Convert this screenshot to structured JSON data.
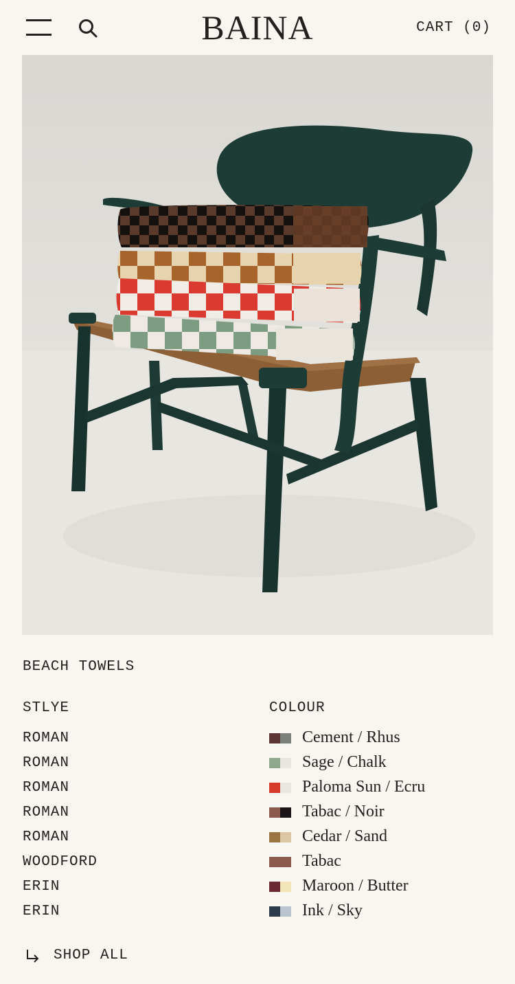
{
  "header": {
    "logo": "BAINA",
    "cart_label": "CART (0)"
  },
  "section": {
    "title": "BEACH TOWELS",
    "style_heading": "STLYE",
    "colour_heading": "COLOUR"
  },
  "products": [
    {
      "style": "ROMAN",
      "colour": "Cement / Rhus",
      "swatch": [
        "#5c3633",
        "#7b807c"
      ]
    },
    {
      "style": "ROMAN",
      "colour": "Sage / Chalk",
      "swatch": [
        "#8ea88d",
        "#e7e6e1"
      ]
    },
    {
      "style": "ROMAN",
      "colour": "Paloma Sun / Ecru",
      "swatch": [
        "#d63a2d",
        "#eae7e2"
      ]
    },
    {
      "style": "ROMAN",
      "colour": "Tabac / Noir",
      "swatch": [
        "#8b5a4c",
        "#1b1518"
      ]
    },
    {
      "style": "ROMAN",
      "colour": "Cedar / Sand",
      "swatch": [
        "#9a7441",
        "#dcc7a5"
      ]
    },
    {
      "style": "WOODFORD",
      "colour": "Tabac",
      "swatch": [
        "#8b5a4c",
        "#8b5a4c"
      ]
    },
    {
      "style": "ERIN",
      "colour": "Maroon / Butter",
      "swatch": [
        "#6b2a33",
        "#f1e5b8"
      ]
    },
    {
      "style": "ERIN",
      "colour": "Ink / Sky",
      "swatch": [
        "#2b3a4c",
        "#b9c4cf"
      ]
    }
  ],
  "shop_all_label": "SHOP ALL",
  "icons": {
    "menu": "menu-icon",
    "search": "search-icon",
    "shop_all": "arrow-down-right-icon"
  }
}
